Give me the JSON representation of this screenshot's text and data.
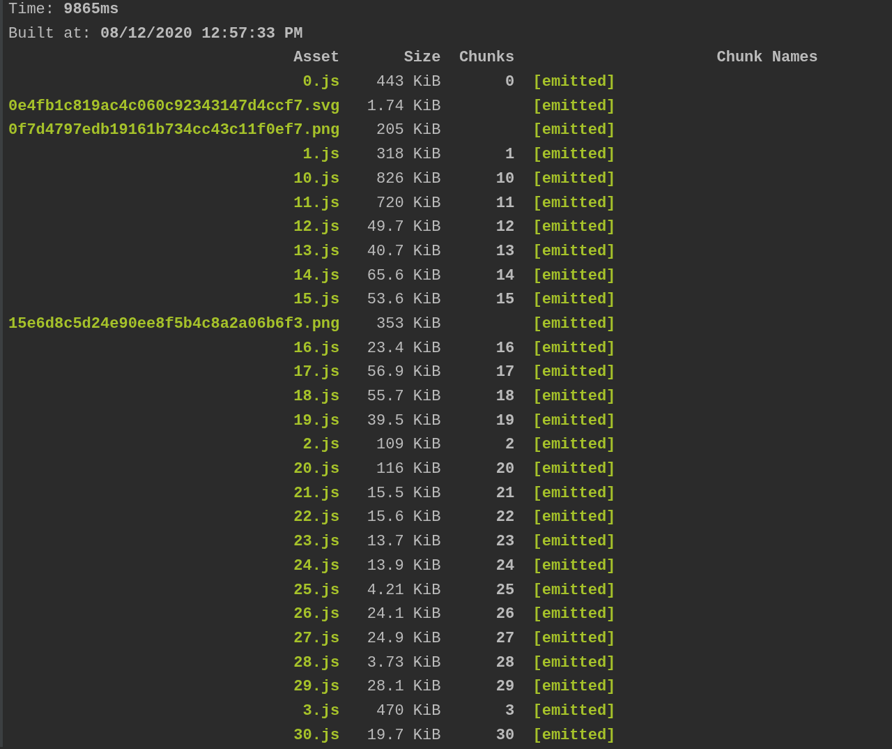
{
  "summary": [
    {
      "label": "Time:",
      "value": "9865ms"
    },
    {
      "label": "Built at:",
      "value": "08/12/2020 12:57:33 PM"
    }
  ],
  "table": {
    "columns": [
      "Asset",
      "Size",
      "Chunks",
      "",
      "Chunk Names"
    ],
    "rows": [
      {
        "asset": "0.js",
        "size": "443 KiB",
        "chunks": "0",
        "status": "[emitted]"
      },
      {
        "asset": "0e4fb1c819ac4c060c92343147d4ccf7.svg",
        "size": "1.74 KiB",
        "status": "[emitted]"
      },
      {
        "asset": "0f7d4797edb19161b734cc43c11f0ef7.png",
        "size": "205 KiB",
        "status": "[emitted]"
      },
      {
        "asset": "1.js",
        "size": "318 KiB",
        "chunks": "1",
        "status": "[emitted]"
      },
      {
        "asset": "10.js",
        "size": "826 KiB",
        "chunks": "10",
        "status": "[emitted]"
      },
      {
        "asset": "11.js",
        "size": "720 KiB",
        "chunks": "11",
        "status": "[emitted]"
      },
      {
        "asset": "12.js",
        "size": "49.7 KiB",
        "chunks": "12",
        "status": "[emitted]"
      },
      {
        "asset": "13.js",
        "size": "40.7 KiB",
        "chunks": "13",
        "status": "[emitted]"
      },
      {
        "asset": "14.js",
        "size": "65.6 KiB",
        "chunks": "14",
        "status": "[emitted]"
      },
      {
        "asset": "15.js",
        "size": "53.6 KiB",
        "chunks": "15",
        "status": "[emitted]"
      },
      {
        "asset": "15e6d8c5d24e90ee8f5b4c8a2a06b6f3.png",
        "size": "353 KiB",
        "status": "[emitted]"
      },
      {
        "asset": "16.js",
        "size": "23.4 KiB",
        "chunks": "16",
        "status": "[emitted]"
      },
      {
        "asset": "17.js",
        "size": "56.9 KiB",
        "chunks": "17",
        "status": "[emitted]"
      },
      {
        "asset": "18.js",
        "size": "55.7 KiB",
        "chunks": "18",
        "status": "[emitted]"
      },
      {
        "asset": "19.js",
        "size": "39.5 KiB",
        "chunks": "19",
        "status": "[emitted]"
      },
      {
        "asset": "2.js",
        "size": "109 KiB",
        "chunks": "2",
        "status": "[emitted]"
      },
      {
        "asset": "20.js",
        "size": "116 KiB",
        "chunks": "20",
        "status": "[emitted]"
      },
      {
        "asset": "21.js",
        "size": "15.5 KiB",
        "chunks": "21",
        "status": "[emitted]"
      },
      {
        "asset": "22.js",
        "size": "15.6 KiB",
        "chunks": "22",
        "status": "[emitted]"
      },
      {
        "asset": "23.js",
        "size": "13.7 KiB",
        "chunks": "23",
        "status": "[emitted]"
      },
      {
        "asset": "24.js",
        "size": "13.9 KiB",
        "chunks": "24",
        "status": "[emitted]"
      },
      {
        "asset": "25.js",
        "size": "4.21 KiB",
        "chunks": "25",
        "status": "[emitted]"
      },
      {
        "asset": "26.js",
        "size": "24.1 KiB",
        "chunks": "26",
        "status": "[emitted]"
      },
      {
        "asset": "27.js",
        "size": "24.9 KiB",
        "chunks": "27",
        "status": "[emitted]"
      },
      {
        "asset": "28.js",
        "size": "3.73 KiB",
        "chunks": "28",
        "status": "[emitted]"
      },
      {
        "asset": "29.js",
        "size": "28.1 KiB",
        "chunks": "29",
        "status": "[emitted]"
      },
      {
        "asset": "3.js",
        "size": "470 KiB",
        "chunks": "3",
        "status": "[emitted]"
      },
      {
        "asset": "30.js",
        "size": "19.7 KiB",
        "chunks": "30",
        "status": "[emitted]"
      }
    ]
  }
}
